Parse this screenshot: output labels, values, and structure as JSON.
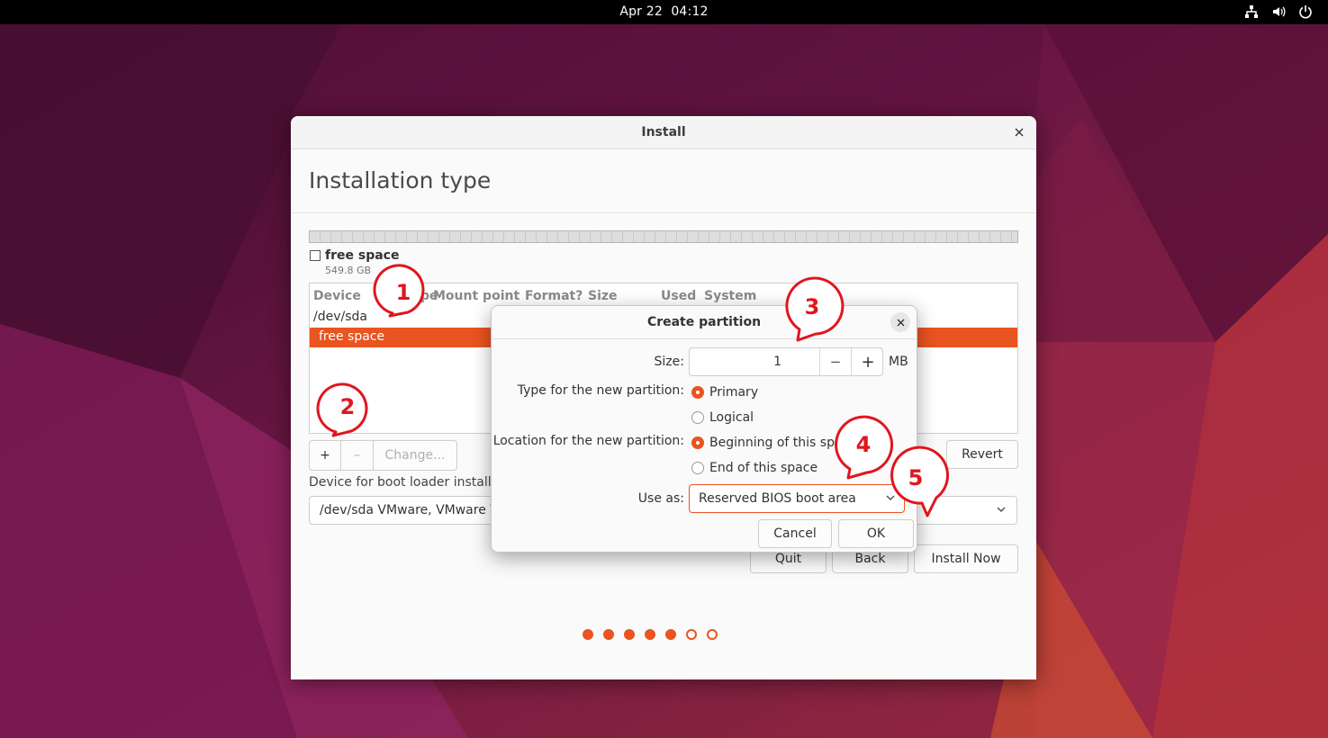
{
  "topbar": {
    "date": "Apr 22",
    "time": "04:12"
  },
  "window": {
    "title": "Install",
    "heading": "Installation type"
  },
  "partition_bar": {
    "legend_label": "free space",
    "legend_size": "549.8 GB"
  },
  "table": {
    "columns": [
      "Device",
      "Type",
      "Mount point",
      "Format?",
      "Size",
      "Used",
      "System"
    ],
    "rows": [
      "/dev/sda",
      "free space"
    ],
    "selected_row": 1
  },
  "toolbar": {
    "add": "+",
    "remove": "–",
    "change": "Change...",
    "revert": "Revert"
  },
  "bootloader": {
    "label": "Device for boot loader installation:",
    "value": "/dev/sda   VMware, VMware Virtual S (536.9 GB)"
  },
  "nav": {
    "quit": "Quit",
    "back": "Back",
    "install_now": "Install Now"
  },
  "progress": {
    "total": 7,
    "completed": 5
  },
  "dialog": {
    "title": "Create partition",
    "size_label": "Size:",
    "size_value": "1",
    "size_unit": "MB",
    "type_label": "Type for the new partition:",
    "type_primary": "Primary",
    "type_logical": "Logical",
    "type_selected": "Primary",
    "location_label": "Location for the new partition:",
    "location_beginning": "Beginning of this space",
    "location_end": "End of this space",
    "location_selected": "Beginning of this space",
    "use_as_label": "Use as:",
    "use_as_value": "Reserved BIOS boot area",
    "cancel": "Cancel",
    "ok": "OK"
  },
  "annotations": [
    "1",
    "2",
    "3",
    "4",
    "5"
  ],
  "colors": {
    "accent": "#e95420",
    "callout": "#e0161e"
  },
  "icons": [
    "network-icon",
    "volume-icon",
    "power-icon",
    "close-icon",
    "chevron-down-icon",
    "minus-icon",
    "plus-icon"
  ]
}
